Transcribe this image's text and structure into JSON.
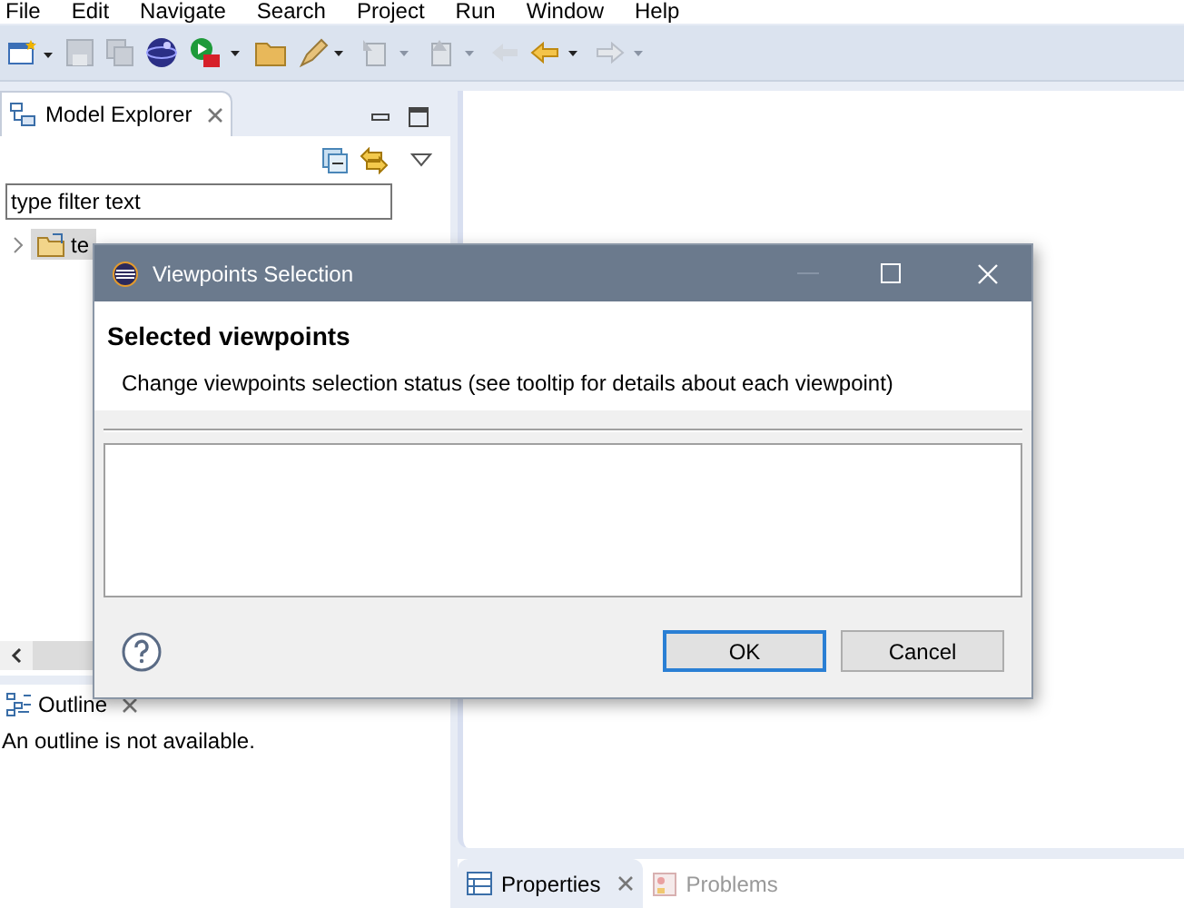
{
  "menu": [
    "File",
    "Edit",
    "Navigate",
    "Search",
    "Project",
    "Run",
    "Window",
    "Help"
  ],
  "model_explorer": {
    "title": "Model Explorer",
    "filter": {
      "placeholder": "type filter text"
    },
    "tree": [
      {
        "label": "te",
        "selected": true,
        "expanded": false
      }
    ]
  },
  "outline": {
    "title": "Outline",
    "message": "An outline is not available."
  },
  "bottom_tabs": [
    {
      "label": "Properties",
      "selected": true
    },
    {
      "label": "Problems",
      "selected": false
    }
  ],
  "dialog": {
    "title": "Viewpoints Selection",
    "heading": "Selected viewpoints",
    "description": "Change viewpoints selection status (see tooltip for details about each viewpoint)",
    "buttons": [
      {
        "label": "OK",
        "default": true
      },
      {
        "label": "Cancel",
        "default": false
      }
    ]
  }
}
